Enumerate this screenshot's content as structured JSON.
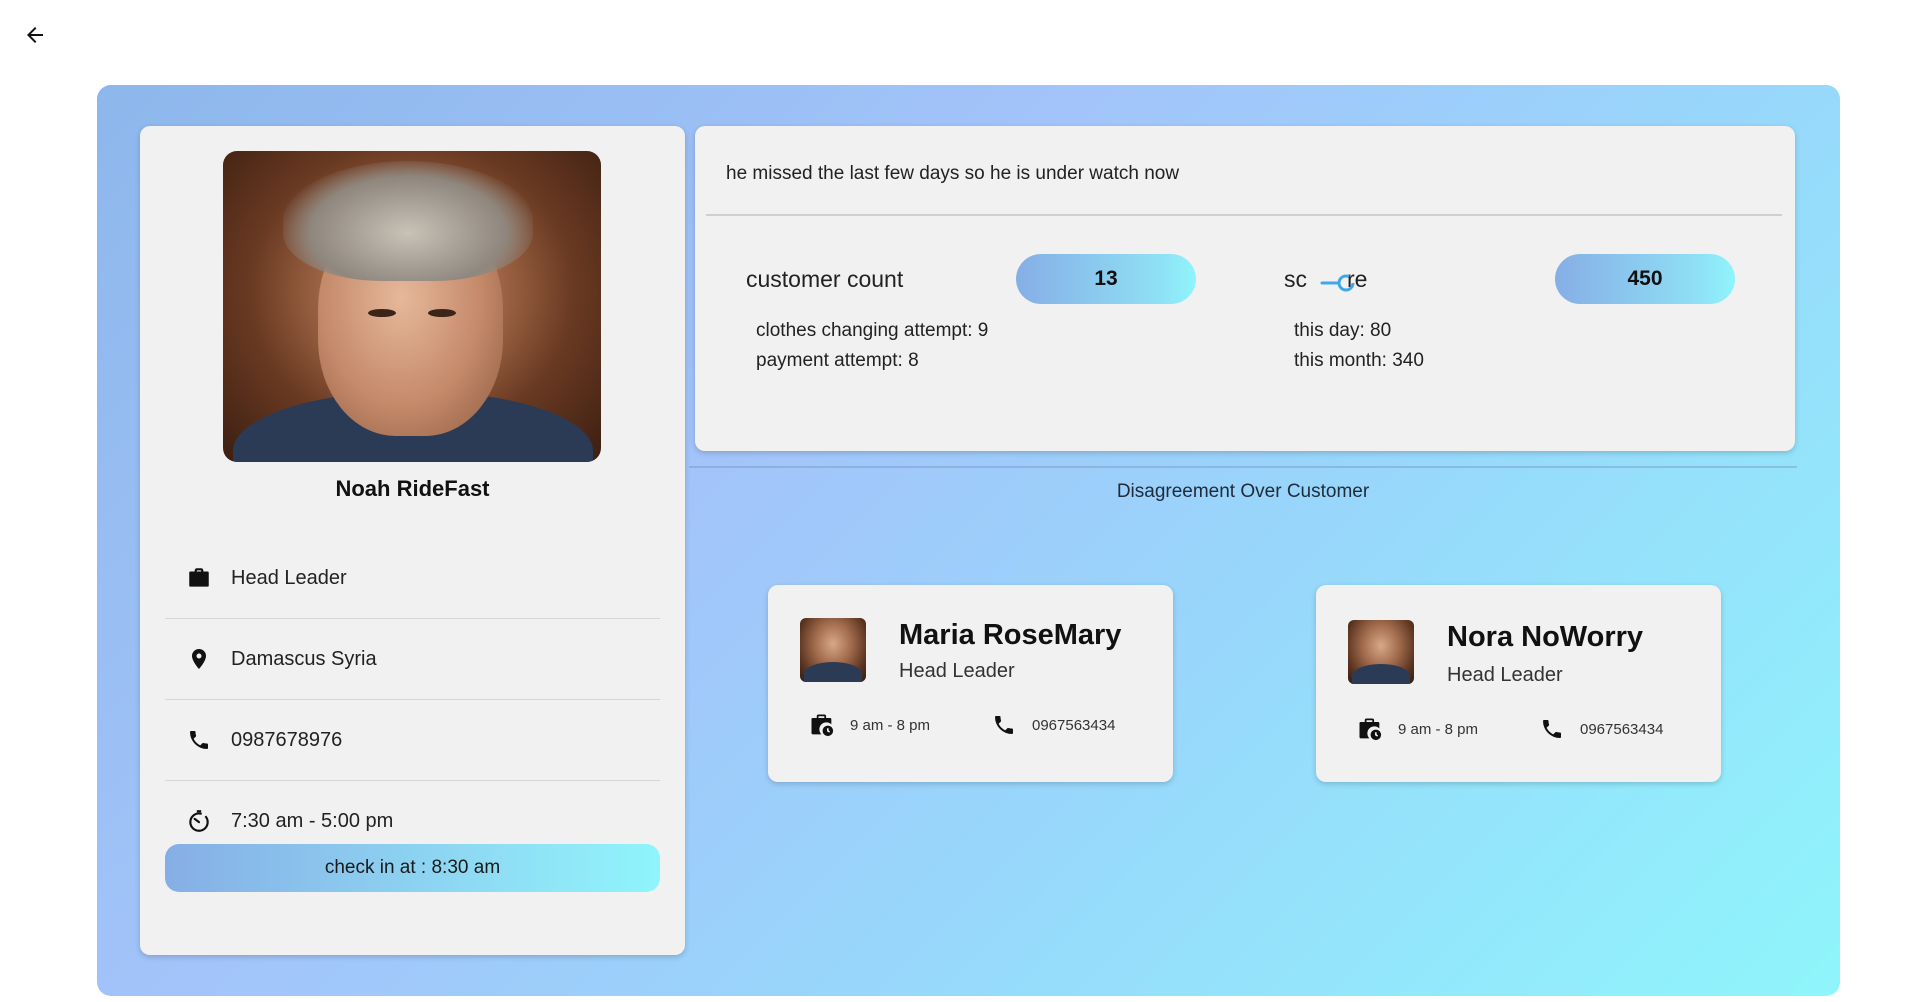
{
  "nav": {
    "back_icon": "arrow-left-icon"
  },
  "profile": {
    "name": "Noah RideFast",
    "photo": "portrait-photo",
    "details": [
      {
        "icon": "briefcase-icon",
        "text": "Head Leader"
      },
      {
        "icon": "location-pin-icon",
        "text": "Damascus Syria"
      },
      {
        "icon": "phone-icon",
        "text": "0987678976"
      },
      {
        "icon": "timer-icon",
        "text": "7:30 am - 5:00 pm"
      }
    ],
    "checkin": "check in at : 8:30 am"
  },
  "stats": {
    "note": "he missed the last few days so he is under watch now",
    "customer_count_label": "customer count",
    "customer_count_value": "13",
    "customer_sub": [
      "clothes changing attempt: 9",
      "payment attempt: 8"
    ],
    "score_label_a": "sc",
    "score_label_b": "re",
    "score_value": "450",
    "score_sub": [
      "this day: 80",
      "this month: 340"
    ]
  },
  "disagreement": {
    "title": "Disagreement Over Customer",
    "people": [
      {
        "name": "Maria RoseMary",
        "role": "Head Leader",
        "hours": "9 am - 8 pm",
        "phone": "0967563434"
      },
      {
        "name": "Nora NoWorry",
        "role": "Head Leader",
        "hours": "9 am - 8 pm",
        "phone": "0967563434"
      }
    ]
  },
  "colors": {
    "gradient_start": "#8db7ec",
    "gradient_end": "#8ff5fb",
    "card_bg": "#f1f1f1"
  }
}
